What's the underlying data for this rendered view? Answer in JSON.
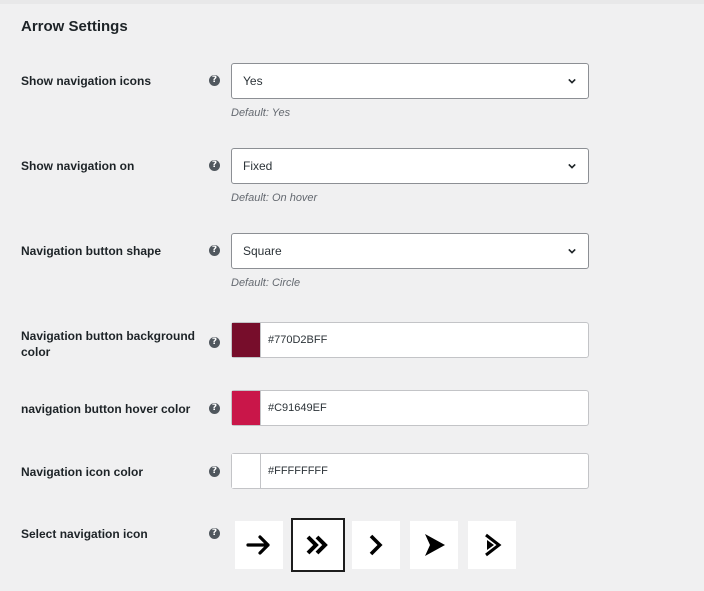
{
  "section_title": "Arrow Settings",
  "rows": {
    "show_icons": {
      "label": "Show navigation icons",
      "value": "Yes",
      "default": "Default: Yes"
    },
    "show_on": {
      "label": "Show navigation on",
      "value": "Fixed",
      "default": "Default: On hover"
    },
    "shape": {
      "label": "Navigation button shape",
      "value": "Square",
      "default": "Default: Circle"
    },
    "bg_color": {
      "label": "Navigation button background color",
      "value": "#770D2BFF",
      "swatch": "#770d2b"
    },
    "hover_color": {
      "label": "navigation button hover color",
      "value": "#C91649EF",
      "swatch": "#c91649"
    },
    "icon_color": {
      "label": "Navigation icon color",
      "value": "#FFFFFFFF",
      "swatch": "#ffffff"
    },
    "select_icon": {
      "label": "Select navigation icon",
      "icons": [
        "arrow-right-icon",
        "double-chevron-right-icon",
        "chevron-right-icon",
        "triangle-right-icon",
        "chevron-triangle-right-icon"
      ],
      "selected": "double-chevron-right-icon"
    }
  },
  "help_glyph": "?"
}
